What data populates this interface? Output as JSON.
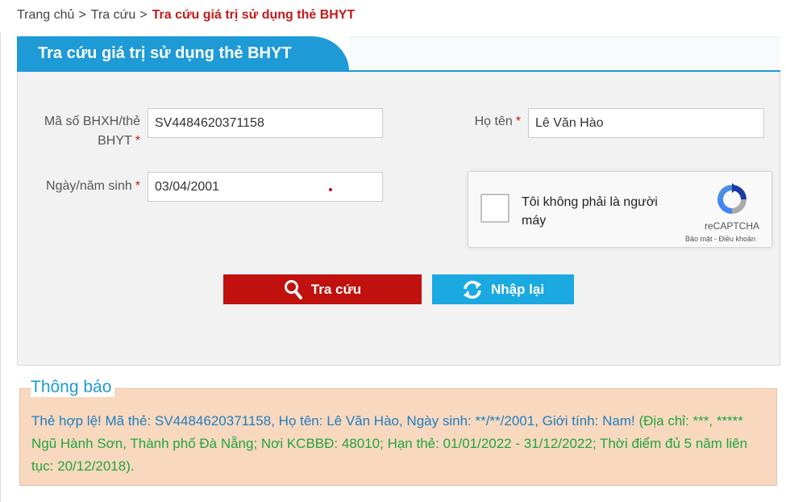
{
  "breadcrumb": {
    "home": "Trang chủ",
    "section": "Tra cứu",
    "current": "Tra cứu giá trị sử dụng thẻ BHYT",
    "separator": ">"
  },
  "panel": {
    "title": "Tra cứu giá trị sử dụng thẻ BHYT"
  },
  "form": {
    "card_label_line1": "Mã số BHXH/thẻ",
    "card_label_line2": "BHYT",
    "card_value": "SV4484620371158",
    "name_label": "Họ tên",
    "name_value": "Lê Văn Hào",
    "dob_label": "Ngày/năm sinh",
    "dob_value": "03/04/2001",
    "required_mark": "*"
  },
  "captcha": {
    "label": "Tôi không phải là người máy",
    "brand": "reCAPTCHA",
    "links": "Bảo mật - Điều khoản",
    "checked": false
  },
  "buttons": {
    "search_label": "Tra cứu",
    "reset_label": "Nhập lại"
  },
  "notice": {
    "title": "Thông báo",
    "main": "Thẻ hợp lệ! Mã thẻ: SV4484620371158, Họ tên: Lê Văn Hào, Ngày sinh: **/**/2001, Giới tính: Nam!",
    "detail": "(Địa chỉ: ***, ***** Ngũ Hành Sơn, Thành phố Đà Nẵng; Nơi KCBBĐ: 48010; Hạn thẻ: 01/01/2022 - 31/12/2022; Thời điểm đủ 5 năm liên tục: 20/12/2018)."
  },
  "colors": {
    "accent_blue": "#1e9ad6",
    "search_red": "#c0110f",
    "reset_blue": "#1ba9e1",
    "notice_bg": "#f8d8bf",
    "notice_green": "#1fa63c"
  }
}
